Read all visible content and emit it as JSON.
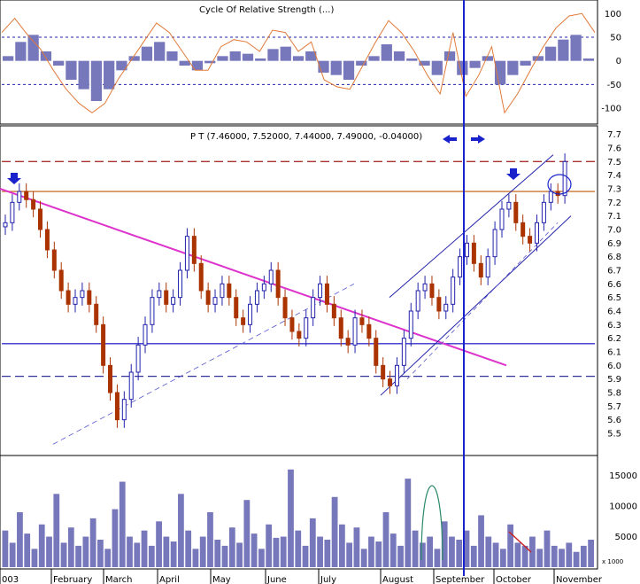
{
  "chart_data": [
    {
      "type": "line",
      "panel": "oscillator",
      "title": "Cycle Of Relative Strength (...)",
      "yticks": [
        100,
        50,
        0,
        -50,
        -100
      ],
      "ylim": [
        -130,
        125
      ],
      "dashed_levels": [
        50,
        -50
      ],
      "series": [
        {
          "values": [
            10,
            40,
            55,
            20,
            -10,
            -40,
            -60,
            -85,
            -60,
            -20,
            10,
            30,
            40,
            20,
            -10,
            -20,
            -5,
            10,
            20,
            15,
            5,
            25,
            30,
            10,
            20,
            -25,
            -30,
            -40,
            -10,
            10,
            35,
            20,
            5,
            -10,
            -30,
            20,
            -30,
            -15,
            10,
            -50,
            -30,
            -10,
            10,
            30,
            45,
            55,
            5
          ]
        },
        {
          "values": [
            60,
            90,
            55,
            25,
            -20,
            -60,
            -90,
            -110,
            -90,
            -40,
            0,
            40,
            80,
            60,
            20,
            -20,
            -20,
            30,
            45,
            40,
            20,
            65,
            60,
            20,
            40,
            -40,
            -55,
            -60,
            -10,
            40,
            85,
            60,
            20,
            -30,
            -70,
            60,
            -75,
            -30,
            30,
            -110,
            -70,
            -20,
            30,
            70,
            95,
            100,
            60
          ]
        }
      ]
    },
    {
      "type": "bar",
      "panel": "price",
      "title": "P T (7.46000, 7.52000, 7.44000, 7.49000, -0.04000)",
      "yticks": [
        7.7,
        7.6,
        7.5,
        7.4,
        7.3,
        7.2,
        7.1,
        7.0,
        6.9,
        6.8,
        6.7,
        6.6,
        6.5,
        6.4,
        6.3,
        6.2,
        6.1,
        6.0,
        5.9,
        5.8,
        5.7,
        5.6,
        5.5
      ],
      "ylim": [
        5.35,
        7.75
      ],
      "close": [
        7.05,
        7.2,
        7.28,
        7.22,
        7.15,
        7.0,
        6.85,
        6.7,
        6.55,
        6.45,
        6.5,
        6.55,
        6.45,
        6.3,
        6.0,
        5.8,
        5.6,
        5.75,
        5.95,
        6.15,
        6.3,
        6.5,
        6.55,
        6.45,
        6.5,
        6.7,
        6.95,
        6.75,
        6.55,
        6.45,
        6.5,
        6.6,
        6.5,
        6.35,
        6.3,
        6.45,
        6.55,
        6.6,
        6.7,
        6.5,
        6.35,
        6.25,
        6.2,
        6.35,
        6.5,
        6.6,
        6.45,
        6.35,
        6.2,
        6.15,
        6.35,
        6.3,
        6.2,
        6.0,
        5.9,
        5.85,
        6.0,
        6.2,
        6.4,
        6.55,
        6.6,
        6.5,
        6.4,
        6.45,
        6.65,
        6.8,
        6.9,
        6.75,
        6.65,
        6.8,
        7.0,
        7.15,
        7.2,
        7.05,
        6.95,
        6.9,
        7.05,
        7.2,
        7.28,
        7.25,
        7.5
      ],
      "horizontal_levels": [
        {
          "value": 7.5,
          "style": "dashed",
          "color": "#aa3333"
        },
        {
          "value": 7.28,
          "style": "solid",
          "color": "#cc7733"
        },
        {
          "value": 6.16,
          "style": "solid",
          "color": "#3333cc"
        },
        {
          "value": 5.92,
          "style": "dashed",
          "color": "#333399"
        }
      ]
    },
    {
      "type": "bar",
      "panel": "volume",
      "yticks": [
        15000,
        10000,
        5000
      ],
      "ylim": [
        0,
        18000
      ],
      "unit_label": "x 1000",
      "values": [
        6000,
        4000,
        9000,
        5500,
        3000,
        7000,
        5000,
        12000,
        4000,
        6500,
        3500,
        5000,
        8000,
        4500,
        3000,
        9500,
        14000,
        5000,
        4000,
        6000,
        3500,
        7500,
        5000,
        4200,
        12000,
        6000,
        3000,
        5000,
        9000,
        4500,
        3500,
        6500,
        4000,
        11000,
        5500,
        3000,
        7000,
        4800,
        5000,
        16000,
        6000,
        3500,
        8000,
        5000,
        4500,
        11500,
        7000,
        4000,
        6500,
        3000,
        5000,
        4200,
        9000,
        5500,
        3500,
        14500,
        6000,
        4000,
        5000,
        3000,
        7500,
        5000,
        4500,
        6000,
        3500,
        8500,
        5000,
        4000,
        3000,
        7000,
        4000,
        3500,
        5000,
        3000,
        6000,
        3500,
        3000,
        4000,
        2500,
        3500,
        4500
      ]
    }
  ],
  "x_axis": {
    "months": [
      "003",
      "February",
      "March",
      "April",
      "May",
      "June",
      "July",
      "August",
      "September",
      "October",
      "November"
    ]
  }
}
